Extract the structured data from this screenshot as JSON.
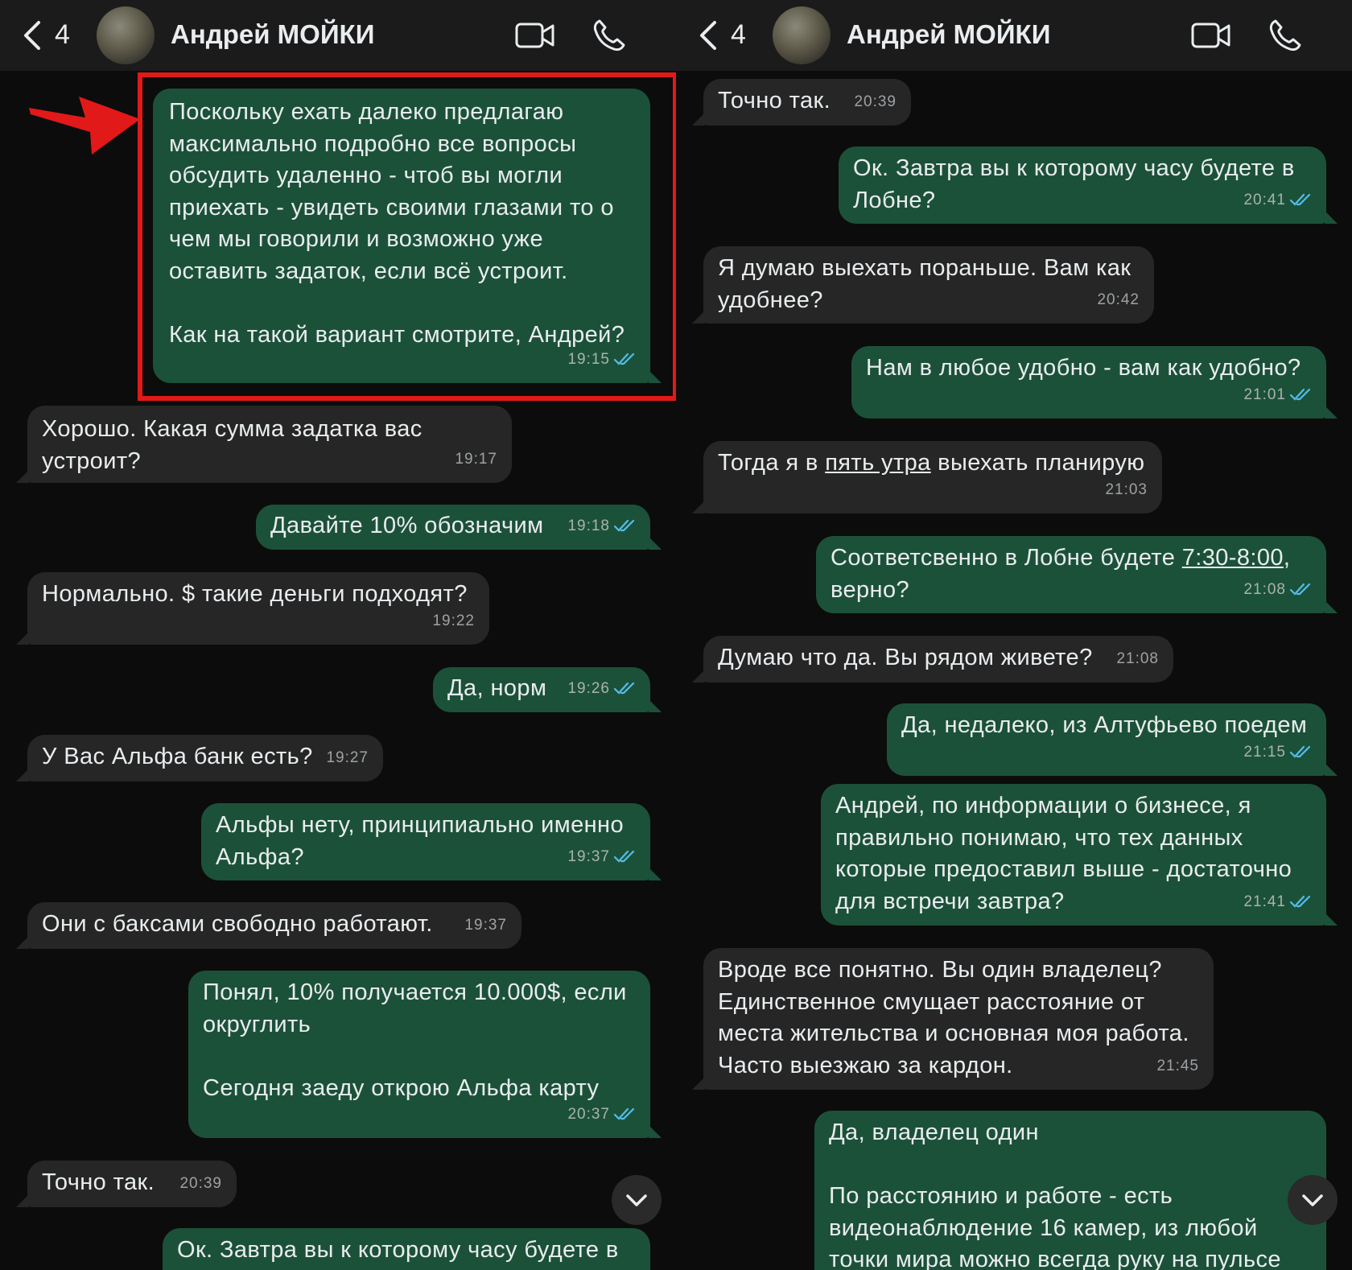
{
  "header": {
    "back_count": "4",
    "chat_name": "Андрей МОЙКИ"
  },
  "left": {
    "messages": [
      {
        "dir": "out",
        "text": "Поскольку ехать далеко предлагаю\nмаксимально подробно все вопросы\nобсудить удаленно - чтоб вы могли\nприехать - увидеть своими глазами то о\nчем мы говорили и возможно уже\nоставить задаток, если всё устроит.\n\nКак на такой вариант смотрите, Андрей?",
        "time": "19:15",
        "read": true
      },
      {
        "dir": "in",
        "text": "Хорошо. Какая сумма задатка вас\nустроит?",
        "time": "19:17"
      },
      {
        "dir": "out",
        "text": "Давайте 10% обозначим",
        "time": "19:18",
        "read": true
      },
      {
        "dir": "in",
        "text": "Нормально. $ такие деньги подходят?",
        "time": "19:22"
      },
      {
        "dir": "out",
        "text": "Да, норм",
        "time": "19:26",
        "read": true
      },
      {
        "dir": "in",
        "text": "У Вас Альфа банк есть?",
        "time": "19:27"
      },
      {
        "dir": "out",
        "text": "Альфы нету, принципиально именно\nАльфа?",
        "time": "19:37",
        "read": true
      },
      {
        "dir": "in",
        "text": "Они с баксами свободно работают.",
        "time": "19:37"
      },
      {
        "dir": "out",
        "text": "Понял, 10% получается 10.000$, если\nокруглить\n\nСегодня заеду открою Альфа карту",
        "time": "20:37",
        "read": true
      },
      {
        "dir": "in",
        "text": "Точно так.",
        "time": "20:39"
      },
      {
        "dir": "out",
        "text": "Ок. Завтра вы к которому часу будете в",
        "time": "",
        "read": false
      }
    ]
  },
  "right": {
    "messages": [
      {
        "dir": "in",
        "text": "Точно так.",
        "time": "20:39"
      },
      {
        "dir": "out",
        "text": "Ок. Завтра вы к которому часу будете в\nЛобне?",
        "time": "20:41",
        "read": true
      },
      {
        "dir": "in",
        "text": "Я думаю выехать пораньше. Вам как\nудобнее?",
        "time": "20:42"
      },
      {
        "dir": "out",
        "text": "Нам в любое удобно - вам как удобно?",
        "time": "21:01",
        "read": true
      },
      {
        "dir": "in",
        "text_before": "Тогда я в ",
        "text_link": "пять утра",
        "text_after": " выехать планирую",
        "time": "21:03"
      },
      {
        "dir": "out",
        "text_before": "Соответсвенно в Лобне будете ",
        "text_link": "7:30-8:00",
        "text_after": ",\nверно?",
        "time": "21:08",
        "read": true
      },
      {
        "dir": "in",
        "text": "Думаю что да. Вы рядом живете?",
        "time": "21:08"
      },
      {
        "dir": "out",
        "text": "Да, недалеко, из Алтуфьево поедем",
        "time": "21:15",
        "read": true
      },
      {
        "dir": "out",
        "text": "Андрей, по информации о бизнесе, я\nправильно понимаю, что тех данных\nкоторые предоставил выше - достаточно\nдля встречи завтра?",
        "time": "21:41",
        "read": true
      },
      {
        "dir": "in",
        "text": "Вроде все понятно. Вы один владелец?\nЕдинственное смущает расстояние от\nместа жительства и основная моя работа.\nЧасто выезжаю за кардон.",
        "time": "21:45"
      },
      {
        "dir": "out",
        "text": "Да, владелец один\n\nПо расстоянию и работе - есть\nвидеонаблюдение 16 камер, из любой\nточки мира можно всегда руку на пульсе",
        "time": "",
        "read": false
      }
    ]
  },
  "colors": {
    "background": "#0c0c0c",
    "header": "#1b1b1b",
    "incoming_bubble": "#262626",
    "outgoing_bubble": "#1c5139",
    "read_ticks": "#53bdeb",
    "highlight": "#e11919"
  },
  "icons": [
    "chevron-left-icon",
    "video-camera-icon",
    "phone-icon",
    "double-check-icon",
    "chevron-down-icon",
    "red-arrow-icon"
  ]
}
